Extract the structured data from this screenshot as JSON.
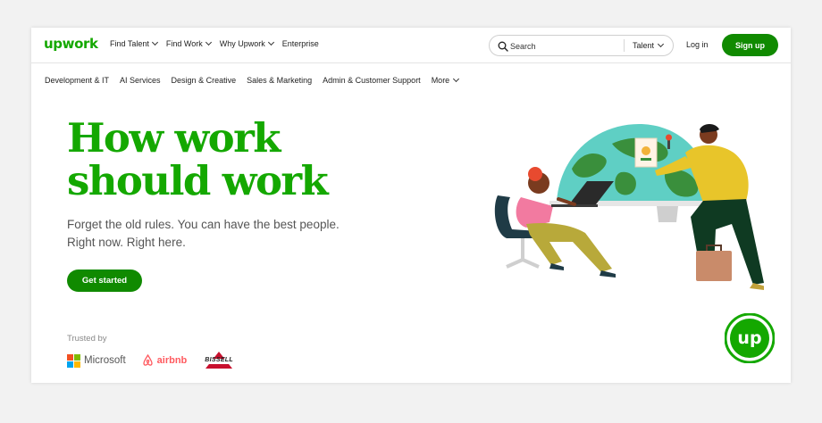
{
  "brand": {
    "logo_text": "upwork",
    "color_green": "#14a800",
    "color_button": "#108a00"
  },
  "topnav": {
    "links": [
      {
        "label": "Find Talent",
        "has_dropdown": true
      },
      {
        "label": "Find Work",
        "has_dropdown": true
      },
      {
        "label": "Why Upwork",
        "has_dropdown": true
      },
      {
        "label": "Enterprise",
        "has_dropdown": false
      }
    ],
    "search": {
      "placeholder": "Search",
      "scope": "Talent",
      "icon": "search-icon"
    },
    "login_label": "Log in",
    "signup_label": "Sign up"
  },
  "categories": [
    "Development & IT",
    "AI Services",
    "Design & Creative",
    "Sales & Marketing",
    "Admin & Customer Support",
    "More"
  ],
  "hero": {
    "title": "How work\nshould work",
    "subtitle": "Forget the old rules. You can have the best people.\nRight now. Right here.",
    "cta_label": "Get started"
  },
  "trusted": {
    "label": "Trusted by",
    "logos": [
      {
        "name": "Microsoft",
        "icon": "microsoft-logo"
      },
      {
        "name": "airbnb",
        "icon": "airbnb-logo"
      },
      {
        "name": "BISSELL",
        "icon": "bissell-logo"
      }
    ]
  },
  "badge": {
    "text": "up",
    "icon": "upwork-up-badge"
  }
}
